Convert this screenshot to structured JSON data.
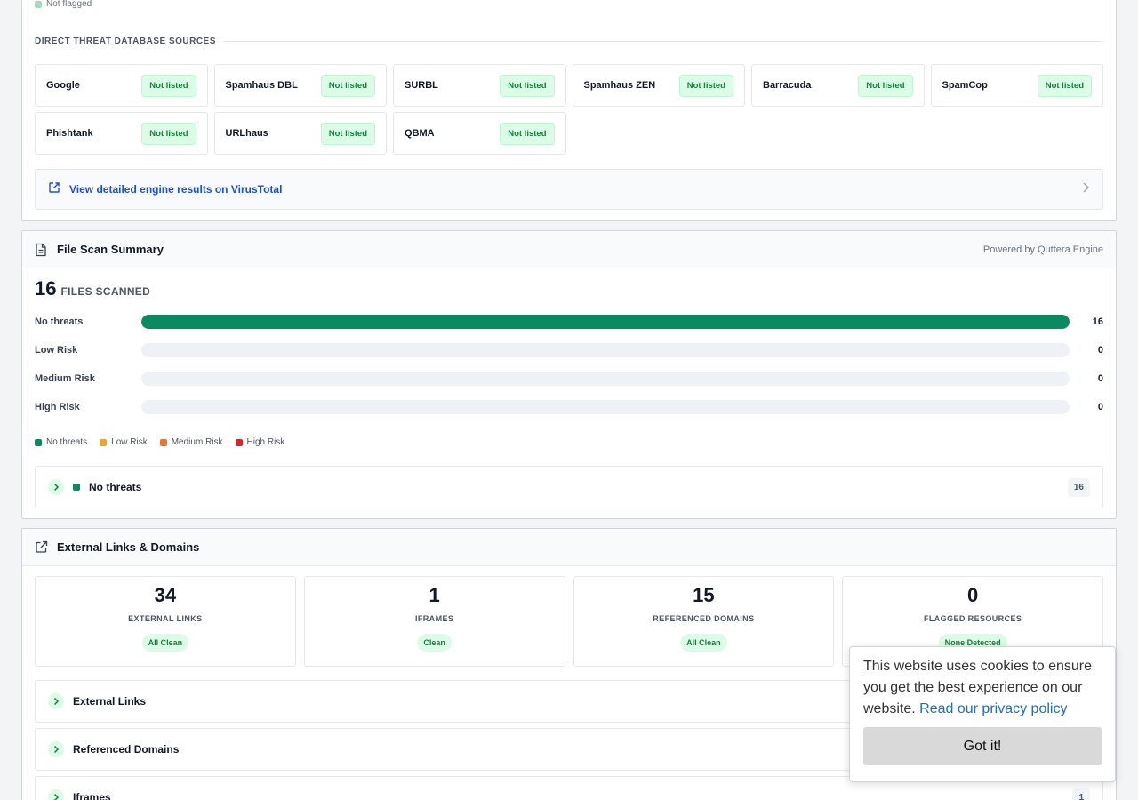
{
  "threat_db": {
    "legend_not_flagged": "Not flagged",
    "section_title": "DIRECT THREAT DATABASE SOURCES",
    "sources": [
      {
        "name": "Google",
        "status": "Not listed"
      },
      {
        "name": "Spamhaus DBL",
        "status": "Not listed"
      },
      {
        "name": "SURBL",
        "status": "Not listed"
      },
      {
        "name": "Spamhaus ZEN",
        "status": "Not listed"
      },
      {
        "name": "Barracuda",
        "status": "Not listed"
      },
      {
        "name": "SpamCop",
        "status": "Not listed"
      },
      {
        "name": "Phishtank",
        "status": "Not listed"
      },
      {
        "name": "URLhaus",
        "status": "Not listed"
      },
      {
        "name": "QBMA",
        "status": "Not listed"
      }
    ],
    "virustotal_link": "View detailed engine results on VirusTotal"
  },
  "file_scan": {
    "title": "File Scan Summary",
    "powered_by": "Powered by Quttera Engine",
    "files_count": "16",
    "files_label": "FILES SCANNED",
    "total": 16,
    "bars": [
      {
        "label": "No threats",
        "value": 16,
        "color": "#0a8a5f"
      },
      {
        "label": "Low Risk",
        "value": 0,
        "color": "#f0a52a"
      },
      {
        "label": "Medium Risk",
        "value": 0,
        "color": "#e8742a"
      },
      {
        "label": "High Risk",
        "value": 0,
        "color": "#dc2626"
      }
    ],
    "legend": [
      {
        "label": "No threats",
        "color": "#0a8a5f"
      },
      {
        "label": "Low Risk",
        "color": "#f0a52a"
      },
      {
        "label": "Medium Risk",
        "color": "#e8742a"
      },
      {
        "label": "High Risk",
        "color": "#dc2626"
      }
    ],
    "accordion": {
      "title": "No threats",
      "count": "16"
    }
  },
  "external": {
    "title": "External Links & Domains",
    "stats": [
      {
        "value": "34",
        "label": "EXTERNAL LINKS",
        "badge": "All Clean"
      },
      {
        "value": "1",
        "label": "IFRAMES",
        "badge": "Clean"
      },
      {
        "value": "15",
        "label": "REFERENCED DOMAINS",
        "badge": "All Clean"
      },
      {
        "value": "0",
        "label": "FLAGGED RESOURCES",
        "badge": "None Detected"
      }
    ],
    "accordions": [
      {
        "title": "External Links",
        "count": ""
      },
      {
        "title": "Referenced Domains",
        "count": ""
      },
      {
        "title": "Iframes",
        "count": "1"
      }
    ]
  },
  "cookie": {
    "message": "This website uses cookies to ensure you get the best experience on our website.",
    "link": "Read our privacy policy",
    "button": "Got it!"
  }
}
